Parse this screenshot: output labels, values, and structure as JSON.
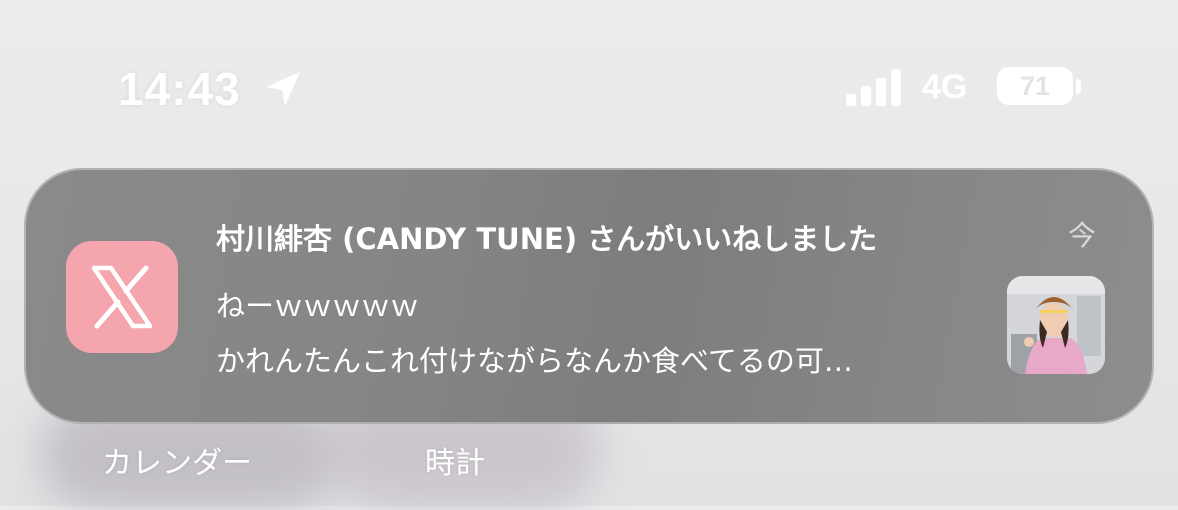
{
  "status_bar": {
    "time": "14:43",
    "network": "4G",
    "battery": "71",
    "icons": [
      "location-arrow-icon",
      "cellular-signal-icon",
      "battery-icon"
    ]
  },
  "notification": {
    "app_icon": "x-logo-icon",
    "app_icon_color": "#f4a5ad",
    "title": "村川緋杏 (CANDY TUNE) さんがいいねしました",
    "time": "今",
    "line1": "ねーｗｗｗｗｗ",
    "line2": "かれんたんこれ付けながらなんか食べてるの可…",
    "thumbnail": "photo-thumbnail"
  },
  "home": {
    "calendar_label": "カレンダー",
    "clock_label": "時計"
  }
}
